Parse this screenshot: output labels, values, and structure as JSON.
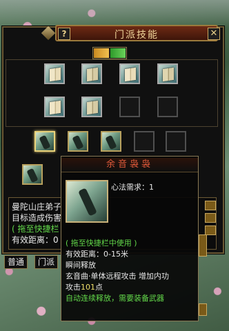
{
  "window": {
    "title": "门派技能",
    "help_label": "?",
    "close_label": "✕"
  },
  "tooltip": {
    "title": "余音袅袅",
    "requirement": "心法需求：1",
    "lines": [
      {
        "text": "( 拖至快捷栏中使用 )",
        "color": "green"
      },
      {
        "text": "有效距离：0-15米",
        "color": "white"
      },
      {
        "text": "瞬间释放",
        "color": "white"
      },
      {
        "text": "玄音曲·单体远程攻击 增加内功",
        "color": "white"
      },
      {
        "text": "攻击",
        "color": "white",
        "num": "101",
        "suffix": "点"
      },
      {
        "text": "自动连续释放，需要装备武器",
        "color": "green"
      }
    ]
  },
  "dialog": {
    "lines": [
      {
        "text": "曼陀山庄弟子",
        "color": "white"
      },
      {
        "text": "目标造成伤害",
        "color": "white"
      },
      {
        "text": "( 拖至快捷栏",
        "color": "green"
      },
      {
        "text": "有效距离：0",
        "color": "white"
      }
    ]
  },
  "bottom_tabs": [
    "普通",
    "门派"
  ],
  "icons": {
    "book": "skill-book-icon",
    "skill": "skill-icon"
  }
}
